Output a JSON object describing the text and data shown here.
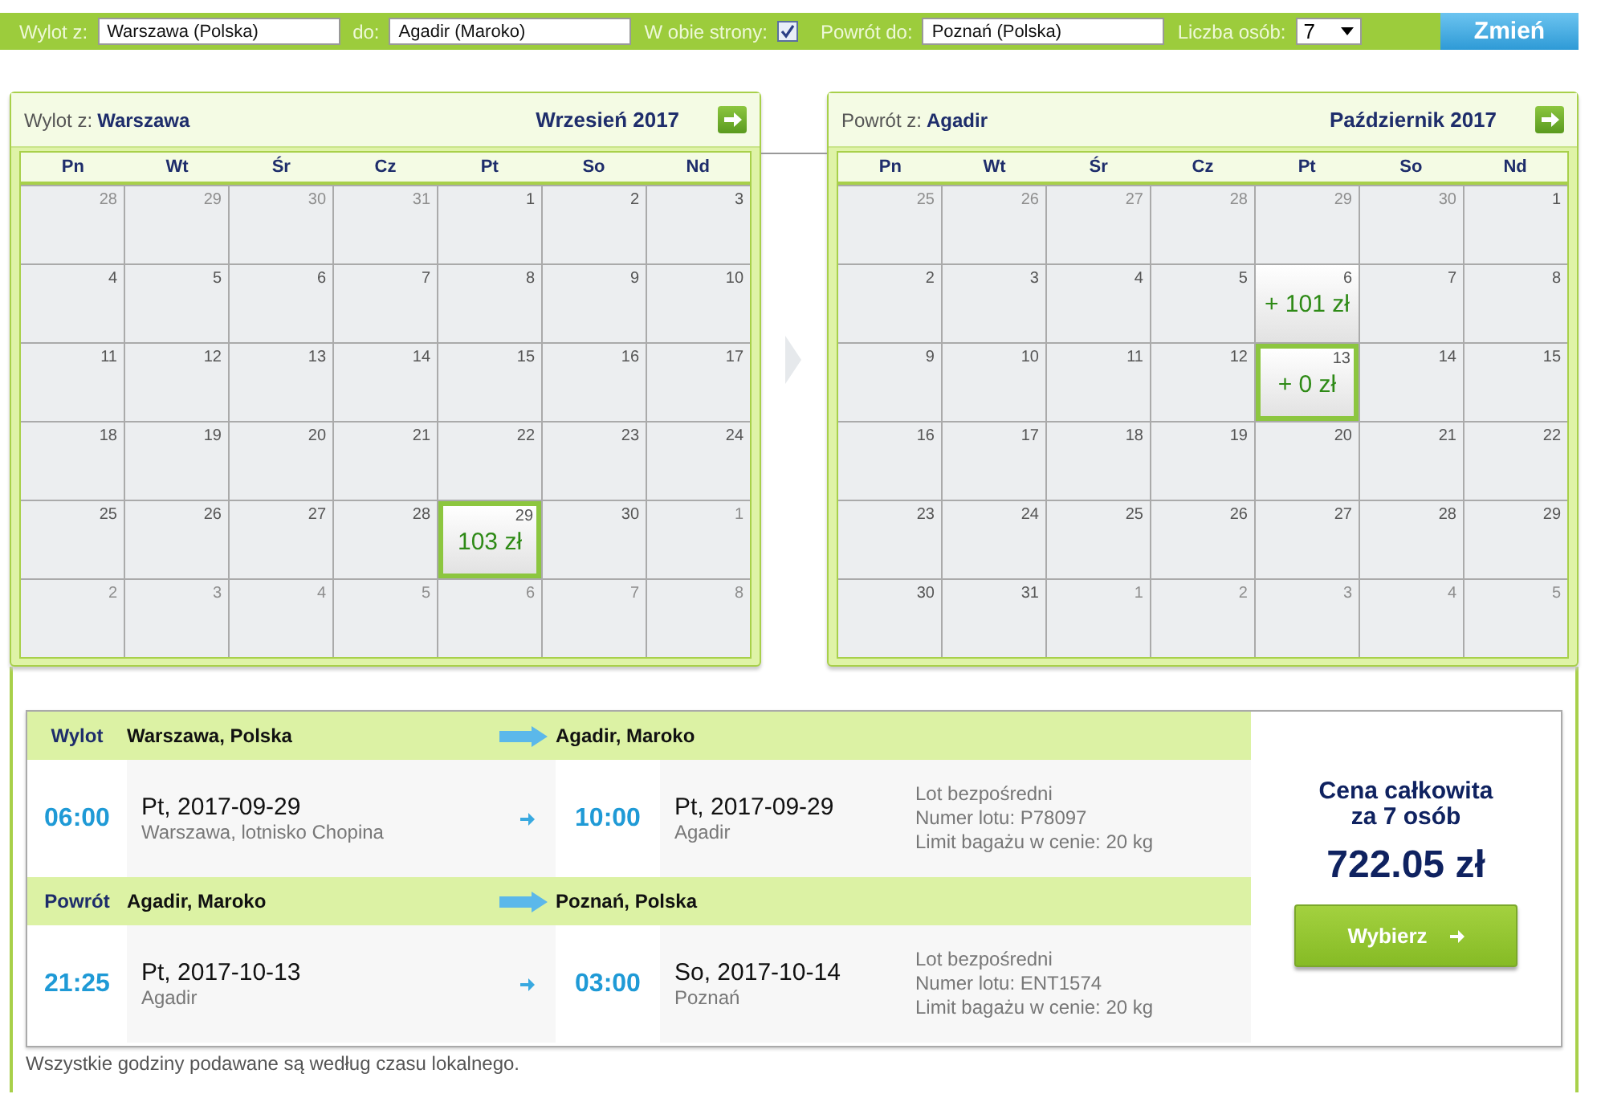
{
  "search_bar": {
    "from_label": "Wylot z:",
    "from": "Warszawa (Polska)",
    "to_label": "do:",
    "to": "Agadir (Maroko)",
    "round_trip_label": "W obie strony:",
    "round_trip": true,
    "return_label": "Powrót do:",
    "return_to": "Poznań (Polska)",
    "persons_label": "Liczba osób:",
    "persons": "7",
    "submit": "Zmień"
  },
  "calendars": [
    {
      "label": "Wylot z:",
      "city": "Warszawa",
      "month": "Wrzesień 2017",
      "weekdays": [
        "Pn",
        "Wt",
        "Śr",
        "Cz",
        "Pt",
        "So",
        "Nd"
      ],
      "weeks": [
        [
          {
            "day": "28",
            "muted": true
          },
          {
            "day": "29",
            "muted": true
          },
          {
            "day": "30",
            "muted": true
          },
          {
            "day": "31",
            "muted": true
          },
          {
            "day": "1",
            "muted": false
          },
          {
            "day": "2",
            "muted": false
          },
          {
            "day": "3",
            "muted": false
          }
        ],
        [
          {
            "day": "4",
            "muted": false
          },
          {
            "day": "5",
            "muted": false
          },
          {
            "day": "6",
            "muted": false
          },
          {
            "day": "7",
            "muted": false
          },
          {
            "day": "8",
            "muted": false
          },
          {
            "day": "9",
            "muted": false
          },
          {
            "day": "10",
            "muted": false
          }
        ],
        [
          {
            "day": "11",
            "muted": false
          },
          {
            "day": "12",
            "muted": false
          },
          {
            "day": "13",
            "muted": false
          },
          {
            "day": "14",
            "muted": false
          },
          {
            "day": "15",
            "muted": false
          },
          {
            "day": "16",
            "muted": false
          },
          {
            "day": "17",
            "muted": false
          }
        ],
        [
          {
            "day": "18",
            "muted": false
          },
          {
            "day": "19",
            "muted": false
          },
          {
            "day": "20",
            "muted": false
          },
          {
            "day": "21",
            "muted": false
          },
          {
            "day": "22",
            "muted": false
          },
          {
            "day": "23",
            "muted": false
          },
          {
            "day": "24",
            "muted": false
          }
        ],
        [
          {
            "day": "25",
            "muted": false
          },
          {
            "day": "26",
            "muted": false
          },
          {
            "day": "27",
            "muted": false
          },
          {
            "day": "28",
            "muted": false
          },
          {
            "day": "29",
            "muted": false,
            "price": "103 zł",
            "selected": true
          },
          {
            "day": "30",
            "muted": false
          },
          {
            "day": "1",
            "muted": true
          }
        ],
        [
          {
            "day": "2",
            "muted": true
          },
          {
            "day": "3",
            "muted": true
          },
          {
            "day": "4",
            "muted": true
          },
          {
            "day": "5",
            "muted": true
          },
          {
            "day": "6",
            "muted": true
          },
          {
            "day": "7",
            "muted": true
          },
          {
            "day": "8",
            "muted": true
          }
        ]
      ]
    },
    {
      "label": "Powrót z:",
      "city": "Agadir",
      "month": "Październik 2017",
      "weekdays": [
        "Pn",
        "Wt",
        "Śr",
        "Cz",
        "Pt",
        "So",
        "Nd"
      ],
      "weeks": [
        [
          {
            "day": "25",
            "muted": true
          },
          {
            "day": "26",
            "muted": true
          },
          {
            "day": "27",
            "muted": true
          },
          {
            "day": "28",
            "muted": true
          },
          {
            "day": "29",
            "muted": true
          },
          {
            "day": "30",
            "muted": true
          },
          {
            "day": "1",
            "muted": false
          }
        ],
        [
          {
            "day": "2",
            "muted": false
          },
          {
            "day": "3",
            "muted": false
          },
          {
            "day": "4",
            "muted": false
          },
          {
            "day": "5",
            "muted": false
          },
          {
            "day": "6",
            "muted": false,
            "price": "+ 101 zł",
            "selected": false
          },
          {
            "day": "7",
            "muted": false
          },
          {
            "day": "8",
            "muted": false
          }
        ],
        [
          {
            "day": "9",
            "muted": false
          },
          {
            "day": "10",
            "muted": false
          },
          {
            "day": "11",
            "muted": false
          },
          {
            "day": "12",
            "muted": false
          },
          {
            "day": "13",
            "muted": false,
            "price": "+ 0 zł",
            "selected": true
          },
          {
            "day": "14",
            "muted": false
          },
          {
            "day": "15",
            "muted": false
          }
        ],
        [
          {
            "day": "16",
            "muted": false
          },
          {
            "day": "17",
            "muted": false
          },
          {
            "day": "18",
            "muted": false
          },
          {
            "day": "19",
            "muted": false
          },
          {
            "day": "20",
            "muted": false
          },
          {
            "day": "21",
            "muted": false
          },
          {
            "day": "22",
            "muted": false
          }
        ],
        [
          {
            "day": "23",
            "muted": false
          },
          {
            "day": "24",
            "muted": false
          },
          {
            "day": "25",
            "muted": false
          },
          {
            "day": "26",
            "muted": false
          },
          {
            "day": "27",
            "muted": false
          },
          {
            "day": "28",
            "muted": false
          },
          {
            "day": "29",
            "muted": false
          }
        ],
        [
          {
            "day": "30",
            "muted": false
          },
          {
            "day": "31",
            "muted": false
          },
          {
            "day": "1",
            "muted": true
          },
          {
            "day": "2",
            "muted": true
          },
          {
            "day": "3",
            "muted": true
          },
          {
            "day": "4",
            "muted": true
          },
          {
            "day": "5",
            "muted": true
          }
        ]
      ]
    }
  ],
  "flights": [
    {
      "label": "Wylot",
      "from": "Warszawa, Polska",
      "to": "Agadir, Maroko",
      "depart_time": "06:00",
      "depart_date": "Pt, 2017-09-29",
      "depart_place": "Warszawa, lotnisko Chopina",
      "arrive_time": "10:00",
      "arrive_date": "Pt, 2017-09-29",
      "arrive_place": "Agadir",
      "info": [
        "Lot bezpośredni",
        "Numer lotu: P78097",
        "Limit bagażu w cenie: 20 kg"
      ]
    },
    {
      "label": "Powrót",
      "from": "Agadir, Maroko",
      "to": "Poznań, Polska",
      "depart_time": "21:25",
      "depart_date": "Pt, 2017-10-13",
      "depart_place": "Agadir",
      "arrive_time": "03:00",
      "arrive_date": "So, 2017-10-14",
      "arrive_place": "Poznań",
      "info": [
        "Lot bezpośredni",
        "Numer lotu: ENT1574",
        "Limit bagażu w cenie: 20 kg"
      ]
    }
  ],
  "price": {
    "title": [
      "Cena całkowita",
      "za 7 osób"
    ],
    "amount": "722.05 zł",
    "button": "Wybierz"
  },
  "footnote": "Wszystkie godziny podawane są według czasu lokalnego."
}
